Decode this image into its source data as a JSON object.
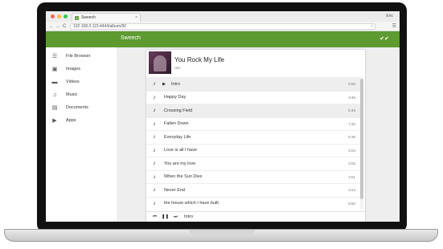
{
  "colors": {
    "accent": "#5d9b31",
    "selected_row": "#eeeeee"
  },
  "browser": {
    "tab_title": "Sweech",
    "tab_favicon_letter": "S",
    "tab_close": "×",
    "profile": "Eric",
    "url": "192.168.0.115:4444/album/90",
    "back_glyph": "←",
    "forward_glyph": "→",
    "reload_glyph": "C"
  },
  "app": {
    "title": "Sweech"
  },
  "sidebar": {
    "items": [
      {
        "label": "File Browser",
        "icon": "list-icon"
      },
      {
        "label": "Images",
        "icon": "camera-icon"
      },
      {
        "label": "Videos",
        "icon": "film-icon"
      },
      {
        "label": "Music",
        "icon": "music-icon"
      },
      {
        "label": "Documents",
        "icon": "document-icon"
      },
      {
        "label": "Apps",
        "icon": "apps-icon"
      }
    ]
  },
  "album": {
    "title": "You Rock My Life",
    "artist": "HEI"
  },
  "tracks": [
    {
      "title": "Intro",
      "duration": "0:50",
      "playing": true
    },
    {
      "title": "Happy Day",
      "duration": "3:46"
    },
    {
      "title": "Crossing Field",
      "duration": "5:46"
    },
    {
      "title": "Fallen Down",
      "duration": "7:20"
    },
    {
      "title": "Everyday Life",
      "duration": "5:36"
    },
    {
      "title": "Love is all I have",
      "duration": "4:04"
    },
    {
      "title": "You are my love",
      "duration": "3:02"
    },
    {
      "title": "When the Sun Dies",
      "duration": "4:51"
    },
    {
      "title": "Never End",
      "duration": "3:24"
    },
    {
      "title": "the house which I have built",
      "duration": "6:50"
    }
  ],
  "player": {
    "current_track": "Intro"
  }
}
